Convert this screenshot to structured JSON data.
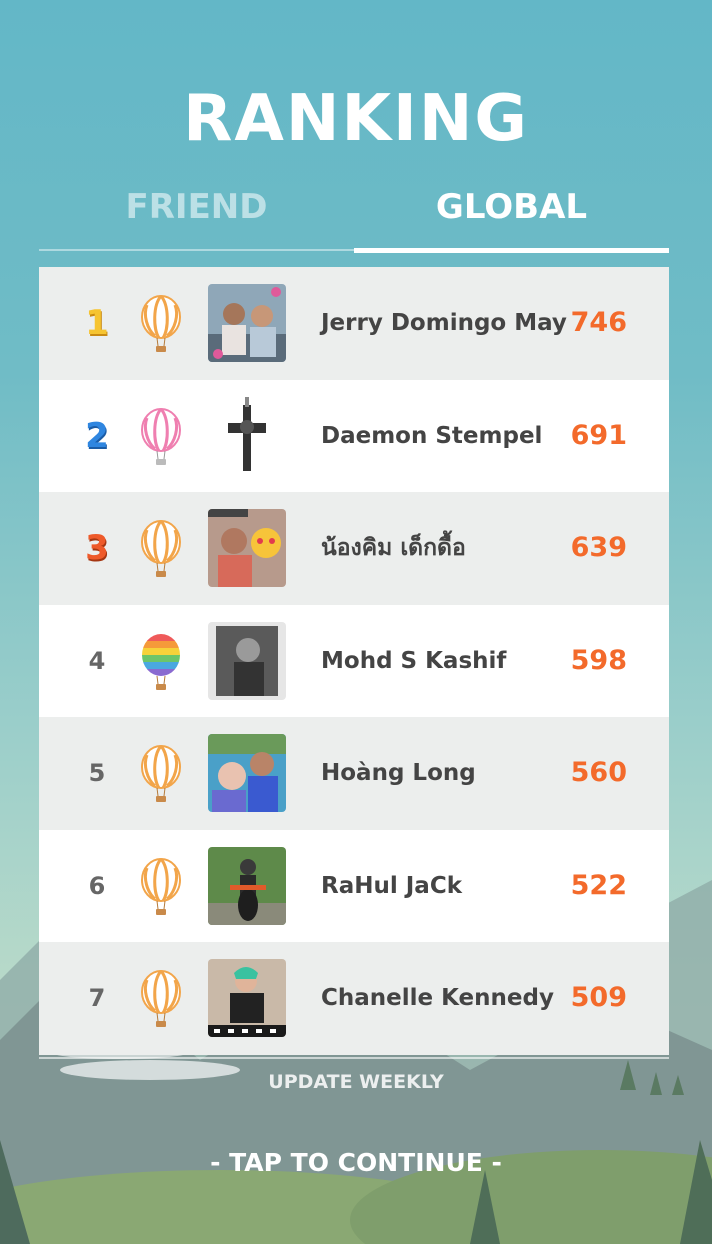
{
  "header": {
    "title": "RANKING"
  },
  "tabs": {
    "friend": "FRIEND",
    "global": "GLOBAL",
    "active": "global"
  },
  "rankings": [
    {
      "rank": "1",
      "name": "Jerry Domingo May",
      "score": "746",
      "balloon": "orange-striped-balloon",
      "medal": "gold"
    },
    {
      "rank": "2",
      "name": "Daemon Stempel",
      "score": "691",
      "balloon": "pink-striped-balloon",
      "medal": "blue"
    },
    {
      "rank": "3",
      "name": "น้องคิม เด็กดื้อ",
      "score": "639",
      "balloon": "orange-striped-balloon",
      "medal": "red"
    },
    {
      "rank": "4",
      "name": "Mohd S Kashif",
      "score": "598",
      "balloon": "rainbow-balloon"
    },
    {
      "rank": "5",
      "name": "Hoàng Long",
      "score": "560",
      "balloon": "orange-striped-balloon"
    },
    {
      "rank": "6",
      "name": "RaHul JaCk",
      "score": "522",
      "balloon": "orange-striped-balloon"
    },
    {
      "rank": "7",
      "name": "Chanelle Kennedy",
      "score": "509",
      "balloon": "orange-striped-balloon"
    }
  ],
  "footer": {
    "update_note": "UPDATE WEEKLY",
    "continue": "-  TAP TO CONTINUE  -"
  },
  "colors": {
    "score": "#f36a2b",
    "sky_top": "#63b7c7",
    "gold_medal": "#f6c431",
    "blue_medal": "#2f86e0",
    "red_medal": "#ee5a2a"
  }
}
